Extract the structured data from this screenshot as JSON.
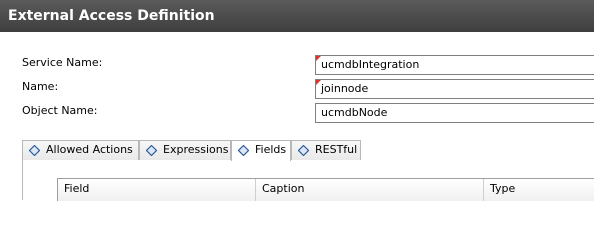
{
  "window": {
    "title": "External Access Definition"
  },
  "form": {
    "service_name": {
      "label": "Service Name:",
      "value": "ucmdbIntegration"
    },
    "name": {
      "label": "Name:",
      "value": "joinnode"
    },
    "object_name": {
      "label": "Object Name:",
      "value": "ucmdbNode"
    }
  },
  "tabs": [
    {
      "label": "Allowed Actions",
      "icon": "diamond-icon"
    },
    {
      "label": "Expressions",
      "icon": "diamond-icon"
    },
    {
      "label": "Fields",
      "icon": "diamond-icon",
      "active": true
    },
    {
      "label": "RESTful",
      "icon": "diamond-icon"
    }
  ],
  "fields_table": {
    "columns": [
      "Field",
      "Caption",
      "Type"
    ]
  },
  "colors": {
    "title_bar": "#4a4a4a",
    "required_marker": "#e0332a",
    "tab_icon": "#2a5a9c"
  }
}
